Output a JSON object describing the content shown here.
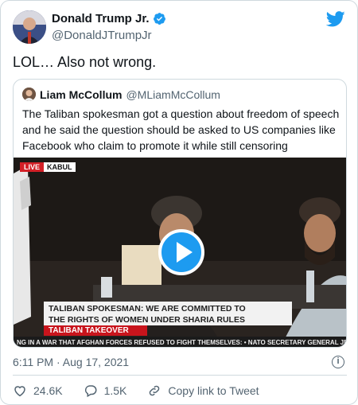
{
  "author": {
    "name": "Donald Trump Jr.",
    "handle": "@DonaldJTrumpJr"
  },
  "tweet": {
    "text": "LOL… Also not wrong."
  },
  "quoted": {
    "name": "Liam McCollum",
    "handle": "@MLiamMcCollum",
    "text": "The Taliban spokesman got a question about freedom of speech and he said the question should be asked to US companies like Facebook who claim to promote it while still censoring",
    "video": {
      "live_label": "LIVE",
      "location_label": "KABUL",
      "chyron_line1": "TALIBAN SPOKESMAN: WE ARE COMMITTED TO",
      "chyron_line2": "THE RIGHTS OF WOMEN UNDER SHARIA RULES",
      "chyron_tag": "TALIBAN TAKEOVER",
      "ticker": "NG IN A WAR THAT AFGHAN FORCES REFUSED TO FIGHT THEMSELVES:  •  NATO SECRETARY GENERAL JEN"
    }
  },
  "timestamp": "6:11 PM · Aug 17, 2021",
  "actions": {
    "likes": "24.6K",
    "replies": "1.5K",
    "copy_link": "Copy link to Tweet"
  },
  "colors": {
    "brand": "#1d9bf0",
    "like": "#f91880",
    "secondary_text": "#536471"
  }
}
